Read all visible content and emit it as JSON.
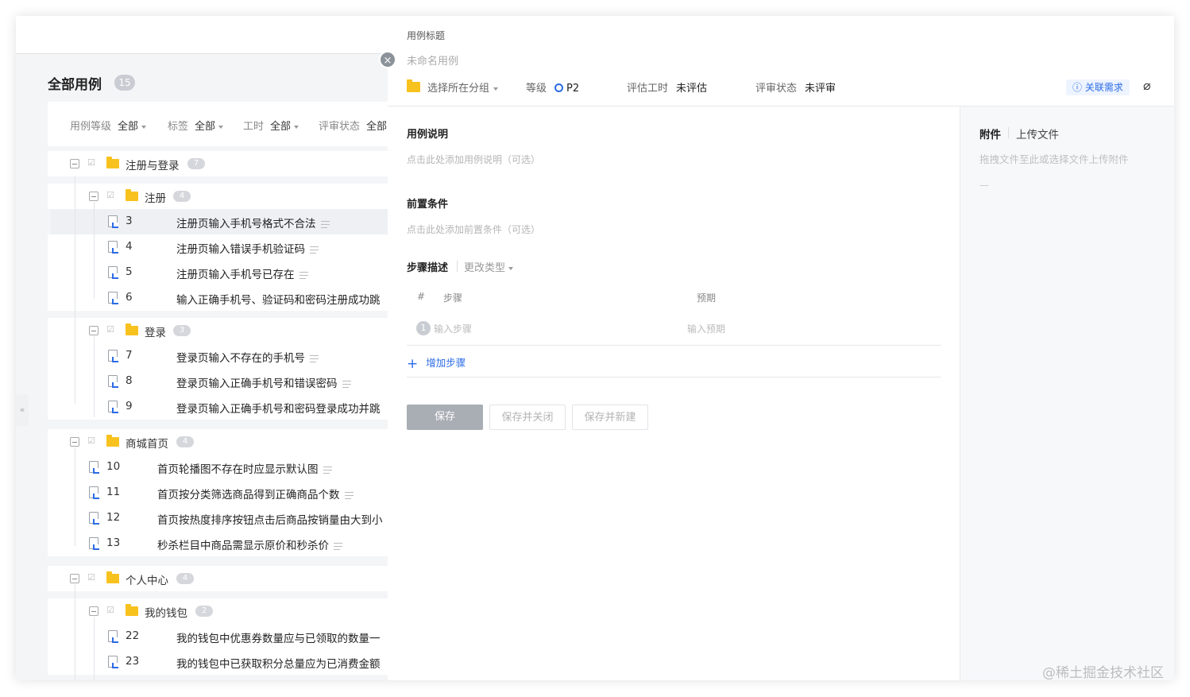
{
  "left": {
    "title": "全部用例",
    "count": "15",
    "filters": [
      {
        "label": "用例等级",
        "value": "全部"
      },
      {
        "label": "标签",
        "value": "全部"
      },
      {
        "label": "工时",
        "value": "全部"
      },
      {
        "label": "评审状态",
        "value": "全部"
      }
    ],
    "groups": {
      "g1": {
        "name": "注册与登录",
        "count": "7"
      },
      "g1a": {
        "name": "注册",
        "count": "4"
      },
      "g1b": {
        "name": "登录",
        "count": "3"
      },
      "g2": {
        "name": "商城首页",
        "count": "4"
      },
      "g3": {
        "name": "个人中心",
        "count": "4"
      },
      "g3a": {
        "name": "我的钱包",
        "count": "2"
      }
    },
    "cases": [
      {
        "id": "3",
        "title": "注册页输入手机号格式不合法"
      },
      {
        "id": "4",
        "title": "注册页输入错误手机验证码"
      },
      {
        "id": "5",
        "title": "注册页输入手机号已存在"
      },
      {
        "id": "6",
        "title": "输入正确手机号、验证码和密码注册成功跳"
      },
      {
        "id": "7",
        "title": "登录页输入不存在的手机号"
      },
      {
        "id": "8",
        "title": "登录页输入正确手机号和错误密码"
      },
      {
        "id": "9",
        "title": "登录页输入正确手机号和密码登录成功并跳"
      },
      {
        "id": "10",
        "title": "首页轮播图不存在时应显示默认图"
      },
      {
        "id": "11",
        "title": "首页按分类筛选商品得到正确商品个数"
      },
      {
        "id": "12",
        "title": "首页按热度排序按钮点击后商品按销量由大到小"
      },
      {
        "id": "13",
        "title": "秒杀栏目中商品需显示原价和秒杀价"
      },
      {
        "id": "22",
        "title": "我的钱包中优惠券数量应与已领取的数量一"
      },
      {
        "id": "23",
        "title": "我的钱包中已获取积分总量应为已消费金额"
      }
    ],
    "collapse_glyph": "«",
    "close_glyph": "×"
  },
  "drawer": {
    "title_label": "用例标题",
    "title_placeholder": "未命名用例",
    "group_select": "选择所在分组",
    "level_label": "等级",
    "level_value": "P2",
    "estimate_label": "评估工时",
    "estimate_value": "未评估",
    "review_label": "评审状态",
    "review_value": "未评审",
    "link_req": "关联需求",
    "clip_glyph": "⌀",
    "desc_title": "用例说明",
    "desc_placeholder": "点击此处添加用例说明（可选）",
    "pre_title": "前置条件",
    "pre_placeholder": "点击此处添加前置条件（可选）",
    "steps_title": "步骤描述",
    "change_type": "更改类型",
    "col_num": "#",
    "col_step": "步骤",
    "col_expect": "预期",
    "step_no": "1",
    "step_placeholder": "输入步骤",
    "expect_placeholder": "输入预期",
    "add_step": "增加步骤",
    "btn_save": "保存",
    "btn_save_close": "保存并关闭",
    "btn_save_new": "保存并新建",
    "attach_title": "附件",
    "attach_upload": "上传文件",
    "attach_hint": "拖拽文件至此或选择文件上传附件",
    "attach_dash": "—"
  },
  "watermark": "@稀土掘金技术社区"
}
